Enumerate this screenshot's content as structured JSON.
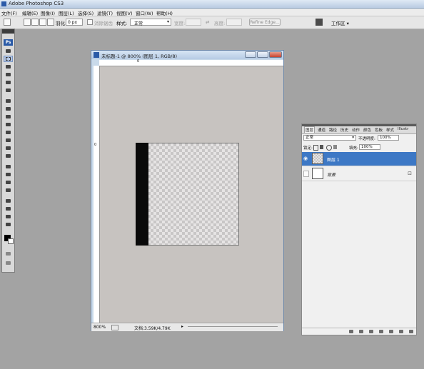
{
  "app": {
    "title": "Adobe Photoshop CS3"
  },
  "menu": [
    "文件(F)",
    "编辑(E)",
    "图像(I)",
    "图层(L)",
    "选择(S)",
    "滤镜(T)",
    "视图(V)",
    "窗口(W)",
    "帮助(H)"
  ],
  "options": {
    "feather_label": "羽化:",
    "feather_value": "0 px",
    "antialias_label": "消除锯齿",
    "style_label": "样式:",
    "style_value": "正常",
    "width_label": "宽度:",
    "height_label": "高度:",
    "refine_edge": "Refine Edge...",
    "workspace": "工作区 ▾"
  },
  "tools": {
    "logo": "Ps"
  },
  "document": {
    "title": "未标题-1 @ 800% (图层 1, RGB/8)",
    "ruler_mark": "0",
    "ruler_mark_left": "0",
    "zoom": "800%",
    "doc_info": "文档:3.59K/4.79K"
  },
  "layers_panel": {
    "tabs": [
      "图层",
      "通道",
      "路径",
      "历史",
      "动作",
      "颜色",
      "色板",
      "样式",
      "Illustr"
    ],
    "blend_mode": "正常",
    "opacity_label": "不透明度:",
    "opacity_value": "100%",
    "lock_label": "锁定:",
    "fill_label": "填充:",
    "fill_value": "100%",
    "layers": [
      {
        "name": "图层 1",
        "selected": true,
        "visible": true
      },
      {
        "name": "背景",
        "selected": false,
        "visible": false,
        "locked": true
      }
    ]
  },
  "colors": {
    "accent": "#3d78c5",
    "background": "#a3a3a3"
  }
}
